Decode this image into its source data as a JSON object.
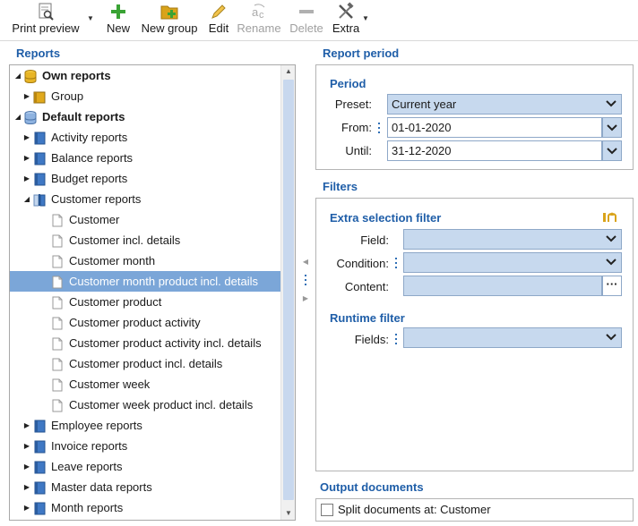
{
  "toolbar": {
    "print_preview": "Print preview",
    "new": "New",
    "new_group": "New group",
    "edit": "Edit",
    "rename": "Rename",
    "delete": "Delete",
    "extra": "Extra"
  },
  "reports_panel": {
    "title": "Reports",
    "tree": [
      {
        "label": "Own reports",
        "level": 0,
        "expanded": true,
        "bold": true,
        "icon": "database-gold-icon"
      },
      {
        "label": "Group",
        "level": 1,
        "expanded": false,
        "icon": "folder-gold-icon"
      },
      {
        "label": "Default reports",
        "level": 0,
        "expanded": true,
        "bold": true,
        "icon": "database-blue-icon"
      },
      {
        "label": "Activity reports",
        "level": 1,
        "expanded": false,
        "icon": "book-icon"
      },
      {
        "label": "Balance reports",
        "level": 1,
        "expanded": false,
        "icon": "book-icon"
      },
      {
        "label": "Budget reports",
        "level": 1,
        "expanded": false,
        "icon": "book-icon"
      },
      {
        "label": "Customer reports",
        "level": 1,
        "expanded": true,
        "icon": "open-book-icon"
      },
      {
        "label": "Customer",
        "level": 2,
        "icon": "document-icon"
      },
      {
        "label": "Customer incl. details",
        "level": 2,
        "icon": "document-icon"
      },
      {
        "label": "Customer month",
        "level": 2,
        "icon": "document-icon"
      },
      {
        "label": "Customer month product incl. details",
        "level": 2,
        "icon": "document-icon",
        "selected": true
      },
      {
        "label": "Customer product",
        "level": 2,
        "icon": "document-icon"
      },
      {
        "label": "Customer product activity",
        "level": 2,
        "icon": "document-icon"
      },
      {
        "label": "Customer product activity incl. details",
        "level": 2,
        "icon": "document-icon"
      },
      {
        "label": "Customer product incl. details",
        "level": 2,
        "icon": "document-icon"
      },
      {
        "label": "Customer week",
        "level": 2,
        "icon": "document-icon"
      },
      {
        "label": "Customer week product incl. details",
        "level": 2,
        "icon": "document-icon"
      },
      {
        "label": "Employee reports",
        "level": 1,
        "expanded": false,
        "icon": "book-icon"
      },
      {
        "label": "Invoice reports",
        "level": 1,
        "expanded": false,
        "icon": "book-icon"
      },
      {
        "label": "Leave reports",
        "level": 1,
        "expanded": false,
        "icon": "book-icon"
      },
      {
        "label": "Master data reports",
        "level": 1,
        "expanded": false,
        "icon": "book-icon"
      },
      {
        "label": "Month reports",
        "level": 1,
        "expanded": false,
        "icon": "book-icon"
      }
    ]
  },
  "report_period": {
    "title": "Report period",
    "group_title": "Period",
    "preset_label": "Preset:",
    "preset_value": "Current year",
    "from_label": "From:",
    "from_value": "01-01-2020",
    "until_label": "Until:",
    "until_value": "31-12-2020"
  },
  "filters": {
    "title": "Filters",
    "extra_selection_title": "Extra selection filter",
    "field_label": "Field:",
    "condition_label": "Condition:",
    "content_label": "Content:",
    "content_button": "···",
    "runtime_title": "Runtime filter",
    "fields_label": "Fields:"
  },
  "output": {
    "title": "Output documents",
    "split_label": "Split documents at: Customer"
  },
  "colors": {
    "accent": "#1f5ea8",
    "selected_row": "#7ba6d8",
    "combo_bg": "#c7d9ee"
  }
}
